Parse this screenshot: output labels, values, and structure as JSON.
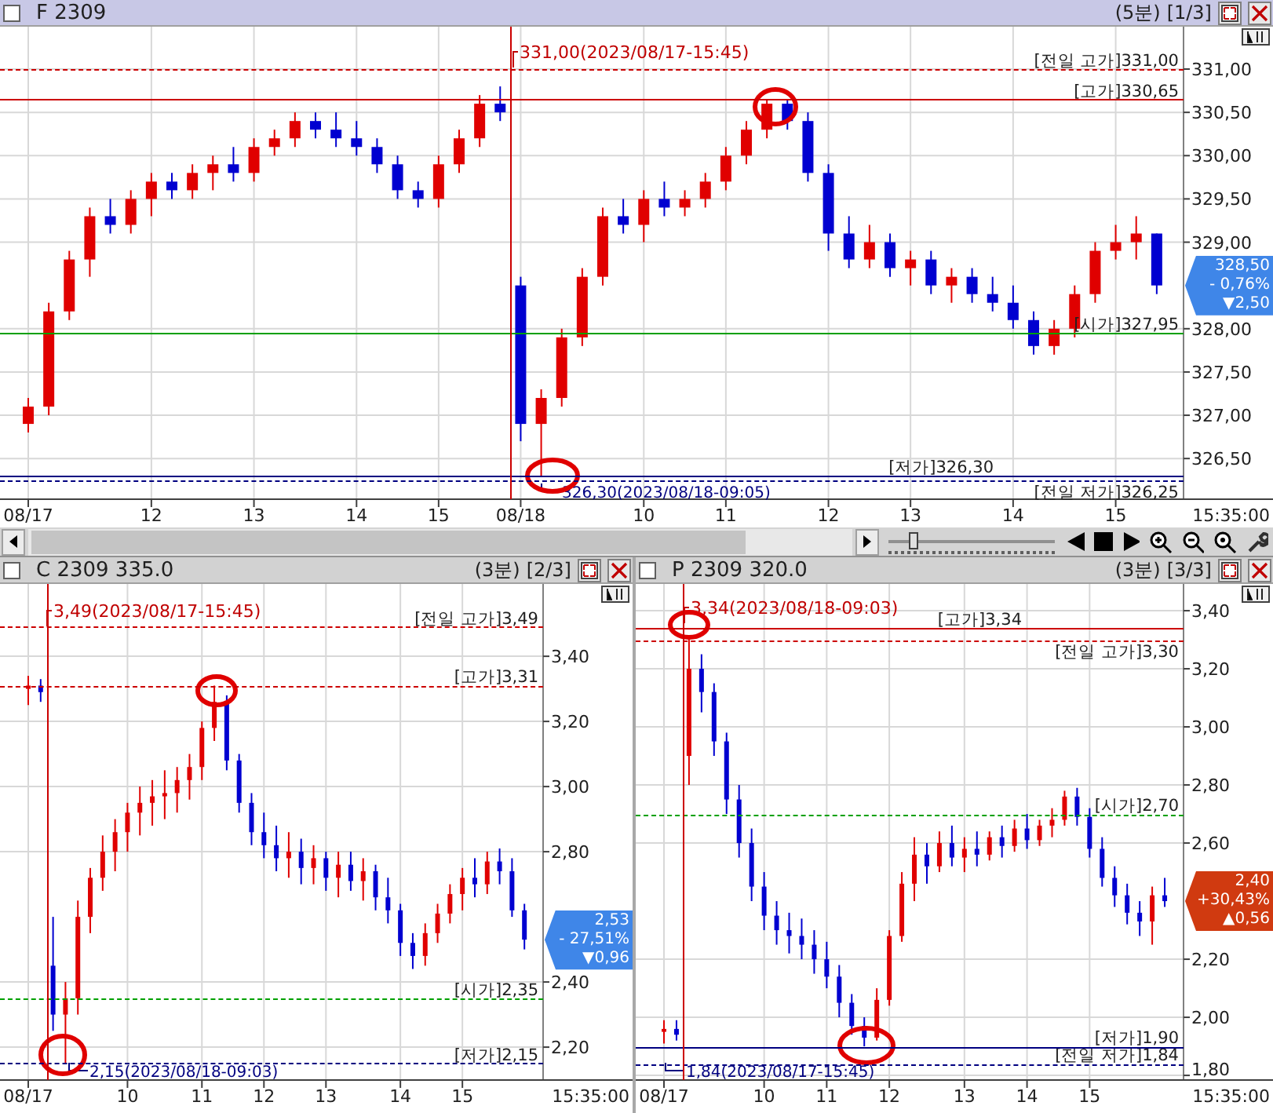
{
  "main_panel": {
    "title": "F 2309",
    "checked": false,
    "period": "(5분)",
    "page": "[1/3]",
    "chart_data": {
      "type": "candlestick",
      "categories": [
        "08/17",
        null,
        null,
        null,
        null,
        null,
        "12",
        null,
        null,
        null,
        null,
        "13",
        null,
        null,
        null,
        null,
        "14",
        null,
        null,
        null,
        "15",
        null,
        null,
        null,
        "08/18",
        null,
        null,
        null,
        null,
        null,
        "10",
        null,
        null,
        null,
        "11",
        null,
        null,
        null,
        null,
        "12",
        null,
        null,
        null,
        "13",
        null,
        null,
        null,
        null,
        "14",
        null,
        null,
        null,
        null,
        "15",
        null,
        null
      ],
      "ohlc": [
        [
          326.9,
          327.2,
          326.8,
          327.1
        ],
        [
          327.1,
          328.3,
          327.0,
          328.2
        ],
        [
          328.2,
          328.9,
          328.1,
          328.8
        ],
        [
          328.8,
          329.4,
          328.6,
          329.3
        ],
        [
          329.3,
          329.5,
          329.1,
          329.2
        ],
        [
          329.2,
          329.6,
          329.1,
          329.5
        ],
        [
          329.5,
          329.8,
          329.3,
          329.7
        ],
        [
          329.7,
          329.8,
          329.5,
          329.6
        ],
        [
          329.6,
          329.9,
          329.5,
          329.8
        ],
        [
          329.8,
          330.0,
          329.6,
          329.9
        ],
        [
          329.9,
          330.1,
          329.7,
          329.8
        ],
        [
          329.8,
          330.2,
          329.7,
          330.1
        ],
        [
          330.1,
          330.3,
          330.0,
          330.2
        ],
        [
          330.2,
          330.5,
          330.1,
          330.4
        ],
        [
          330.4,
          330.5,
          330.2,
          330.3
        ],
        [
          330.3,
          330.5,
          330.1,
          330.2
        ],
        [
          330.2,
          330.4,
          330.0,
          330.1
        ],
        [
          330.1,
          330.2,
          329.8,
          329.9
        ],
        [
          329.9,
          330.0,
          329.5,
          329.6
        ],
        [
          329.6,
          329.7,
          329.4,
          329.5
        ],
        [
          329.5,
          330.0,
          329.4,
          329.9
        ],
        [
          329.9,
          330.3,
          329.8,
          330.2
        ],
        [
          330.2,
          330.7,
          330.1,
          330.6
        ],
        [
          330.6,
          330.8,
          330.4,
          330.5
        ],
        [
          328.5,
          328.6,
          326.7,
          326.9
        ],
        [
          326.9,
          327.3,
          326.3,
          327.2
        ],
        [
          327.2,
          328.0,
          327.1,
          327.9
        ],
        [
          327.9,
          328.7,
          327.8,
          328.6
        ],
        [
          328.6,
          329.4,
          328.5,
          329.3
        ],
        [
          329.3,
          329.5,
          329.1,
          329.2
        ],
        [
          329.2,
          329.6,
          329.0,
          329.5
        ],
        [
          329.5,
          329.7,
          329.3,
          329.4
        ],
        [
          329.4,
          329.6,
          329.3,
          329.5
        ],
        [
          329.5,
          329.8,
          329.4,
          329.7
        ],
        [
          329.7,
          330.1,
          329.6,
          330.0
        ],
        [
          330.0,
          330.4,
          329.9,
          330.3
        ],
        [
          330.3,
          330.65,
          330.2,
          330.6
        ],
        [
          330.6,
          330.65,
          330.3,
          330.4
        ],
        [
          330.4,
          330.5,
          329.7,
          329.8
        ],
        [
          329.8,
          329.9,
          328.9,
          329.1
        ],
        [
          329.1,
          329.3,
          328.7,
          328.8
        ],
        [
          328.8,
          329.2,
          328.7,
          329.0
        ],
        [
          329.0,
          329.1,
          328.6,
          328.7
        ],
        [
          328.7,
          328.9,
          328.5,
          328.8
        ],
        [
          328.8,
          328.9,
          328.4,
          328.5
        ],
        [
          328.5,
          328.7,
          328.3,
          328.6
        ],
        [
          328.6,
          328.7,
          328.3,
          328.4
        ],
        [
          328.4,
          328.6,
          328.2,
          328.3
        ],
        [
          328.3,
          328.5,
          328.0,
          328.1
        ],
        [
          328.1,
          328.2,
          327.7,
          327.8
        ],
        [
          327.8,
          328.1,
          327.7,
          328.0
        ],
        [
          328.0,
          328.5,
          327.9,
          328.4
        ],
        [
          328.4,
          329.0,
          328.3,
          328.9
        ],
        [
          328.9,
          329.2,
          328.8,
          329.0
        ],
        [
          329.0,
          329.3,
          328.8,
          329.1
        ],
        [
          329.1,
          329.1,
          328.4,
          328.5
        ]
      ],
      "ylim": [
        326.03,
        331.49
      ],
      "yticks": [
        {
          "value": 331.0,
          "label": "331,00"
        },
        {
          "value": 330.5,
          "label": "330,50"
        },
        {
          "value": 330.0,
          "label": "330,00"
        },
        {
          "value": 329.5,
          "label": "329,50"
        },
        {
          "value": 329.0,
          "label": "329,00"
        },
        {
          "value": 328.0,
          "label": "328,00"
        },
        {
          "value": 327.5,
          "label": "327,50"
        },
        {
          "value": 327.0,
          "label": "327,00"
        },
        {
          "value": 326.5,
          "label": "326,50"
        }
      ],
      "grid": true,
      "ref_lines": [
        {
          "axis": "y",
          "value": 331.0,
          "label": "[전일 고가]331,00",
          "color": "#cc0000"
        },
        {
          "axis": "y",
          "value": 330.65,
          "label": "[고가]330,65",
          "color": "#cc0000"
        },
        {
          "axis": "y",
          "value": 327.95,
          "label": "[시가]327,95",
          "color": "#00a000"
        },
        {
          "axis": "y",
          "value": 326.3,
          "label": "[저가]326,30",
          "color": "#000080"
        },
        {
          "axis": "y",
          "value": 326.25,
          "label": "[전일 저가]326,25",
          "color": "#000080"
        }
      ]
    },
    "time_label": "15:35:00",
    "high_note": "331,00(2023/08/17-15:45)",
    "low_note": "326,30(2023/08/18-09:05)",
    "badge": {
      "price": "328,50",
      "change_pct": "- 0,76%",
      "change": "▼2,50",
      "color": "#3f86e8"
    }
  },
  "toolbar": {
    "zoom_slider": {
      "level": 0.12
    }
  },
  "sub_panels": [
    {
      "title": "C 2309 335.0",
      "checked": false,
      "period": "(3분)",
      "page": "[2/3]",
      "chart_data": {
        "type": "candlestick",
        "categories": [
          "08/17",
          null,
          null,
          null,
          null,
          null,
          null,
          null,
          "10",
          null,
          null,
          null,
          null,
          null,
          "11",
          null,
          null,
          null,
          null,
          "12",
          null,
          null,
          null,
          null,
          "13",
          null,
          null,
          null,
          null,
          null,
          "14",
          null,
          null,
          null,
          null,
          "15",
          null,
          null,
          null,
          null,
          null
        ],
        "ohlc": [
          [
            3.3,
            3.34,
            3.25,
            3.31
          ],
          [
            3.31,
            3.33,
            3.26,
            3.29
          ],
          [
            2.45,
            2.6,
            2.25,
            2.3
          ],
          [
            2.3,
            2.4,
            2.15,
            2.35
          ],
          [
            2.35,
            2.65,
            2.3,
            2.6
          ],
          [
            2.6,
            2.75,
            2.55,
            2.72
          ],
          [
            2.72,
            2.85,
            2.68,
            2.8
          ],
          [
            2.8,
            2.9,
            2.74,
            2.86
          ],
          [
            2.86,
            2.95,
            2.8,
            2.92
          ],
          [
            2.92,
            3.0,
            2.85,
            2.95
          ],
          [
            2.95,
            3.02,
            2.88,
            2.97
          ],
          [
            2.97,
            3.05,
            2.9,
            2.98
          ],
          [
            2.98,
            3.06,
            2.92,
            3.02
          ],
          [
            3.02,
            3.1,
            2.96,
            3.06
          ],
          [
            3.06,
            3.2,
            3.02,
            3.18
          ],
          [
            3.18,
            3.31,
            3.14,
            3.26
          ],
          [
            3.26,
            3.28,
            3.05,
            3.08
          ],
          [
            3.08,
            3.1,
            2.92,
            2.95
          ],
          [
            2.95,
            2.98,
            2.82,
            2.86
          ],
          [
            2.86,
            2.92,
            2.78,
            2.82
          ],
          [
            2.82,
            2.88,
            2.74,
            2.78
          ],
          [
            2.78,
            2.86,
            2.72,
            2.8
          ],
          [
            2.8,
            2.84,
            2.7,
            2.75
          ],
          [
            2.75,
            2.82,
            2.7,
            2.78
          ],
          [
            2.78,
            2.8,
            2.68,
            2.72
          ],
          [
            2.72,
            2.8,
            2.66,
            2.76
          ],
          [
            2.76,
            2.8,
            2.68,
            2.71
          ],
          [
            2.71,
            2.78,
            2.65,
            2.74
          ],
          [
            2.74,
            2.76,
            2.62,
            2.66
          ],
          [
            2.66,
            2.72,
            2.58,
            2.62
          ],
          [
            2.62,
            2.64,
            2.48,
            2.52
          ],
          [
            2.52,
            2.55,
            2.44,
            2.48
          ],
          [
            2.48,
            2.58,
            2.45,
            2.55
          ],
          [
            2.55,
            2.64,
            2.52,
            2.61
          ],
          [
            2.61,
            2.7,
            2.58,
            2.67
          ],
          [
            2.67,
            2.75,
            2.62,
            2.72
          ],
          [
            2.72,
            2.78,
            2.66,
            2.7
          ],
          [
            2.7,
            2.8,
            2.67,
            2.77
          ],
          [
            2.77,
            2.81,
            2.7,
            2.74
          ],
          [
            2.74,
            2.78,
            2.6,
            2.62
          ],
          [
            2.62,
            2.64,
            2.5,
            2.53
          ]
        ],
        "ylim": [
          2.099,
          3.622
        ],
        "yticks": [
          {
            "value": 3.4,
            "label": "3,40"
          },
          {
            "value": 3.2,
            "label": "3,20"
          },
          {
            "value": 3.0,
            "label": "3,00"
          },
          {
            "value": 2.8,
            "label": "2,80"
          },
          {
            "value": 2.4,
            "label": "2,40"
          },
          {
            "value": 2.2,
            "label": "2,20"
          }
        ],
        "grid": true,
        "ref_lines": [
          {
            "axis": "y",
            "value": 3.49,
            "label": "[전일 고가]3,49",
            "color": "#cc0000"
          },
          {
            "axis": "y",
            "value": 3.31,
            "label": "[고가]3,31",
            "color": "#cc0000"
          },
          {
            "axis": "y",
            "value": 2.35,
            "label": "[시가]2,35",
            "color": "#00a000"
          },
          {
            "axis": "y",
            "value": 2.15,
            "label": "[저가]2,15",
            "color": "#000080"
          }
        ]
      },
      "time_label": "15:35:00",
      "high_note": "3,49(2023/08/17-15:45)",
      "low_note": "2,15(2023/08/18-09:03)",
      "badge": {
        "price": "2,53",
        "change_pct": "- 27,51%",
        "change": "▼0,96",
        "color": "#3f86e8"
      }
    },
    {
      "title": "P 2309 320.0",
      "checked": false,
      "period": "(3분)",
      "page": "[3/3]",
      "chart_data": {
        "type": "candlestick",
        "categories": [
          "08/17",
          null,
          null,
          null,
          null,
          null,
          null,
          null,
          "10",
          null,
          null,
          null,
          null,
          "11",
          null,
          null,
          null,
          null,
          "12",
          null,
          null,
          null,
          null,
          null,
          "13",
          null,
          null,
          null,
          null,
          "14",
          null,
          null,
          null,
          null,
          "15",
          null,
          null,
          null,
          null,
          null,
          null
        ],
        "ohlc": [
          [
            1.95,
            1.99,
            1.91,
            1.96
          ],
          [
            1.96,
            1.99,
            1.92,
            1.94
          ],
          [
            2.9,
            3.3,
            2.8,
            3.2
          ],
          [
            3.2,
            3.25,
            3.05,
            3.12
          ],
          [
            3.12,
            3.15,
            2.9,
            2.95
          ],
          [
            2.95,
            2.98,
            2.7,
            2.75
          ],
          [
            2.75,
            2.8,
            2.55,
            2.6
          ],
          [
            2.6,
            2.65,
            2.4,
            2.45
          ],
          [
            2.45,
            2.5,
            2.3,
            2.35
          ],
          [
            2.35,
            2.4,
            2.25,
            2.3
          ],
          [
            2.3,
            2.36,
            2.22,
            2.28
          ],
          [
            2.28,
            2.34,
            2.2,
            2.25
          ],
          [
            2.25,
            2.3,
            2.15,
            2.2
          ],
          [
            2.2,
            2.26,
            2.1,
            2.14
          ],
          [
            2.14,
            2.18,
            2.0,
            2.05
          ],
          [
            2.05,
            2.08,
            1.94,
            1.97
          ],
          [
            1.97,
            2.0,
            1.9,
            1.93
          ],
          [
            1.93,
            2.1,
            1.92,
            2.06
          ],
          [
            2.06,
            2.3,
            2.04,
            2.28
          ],
          [
            2.28,
            2.5,
            2.26,
            2.46
          ],
          [
            2.46,
            2.62,
            2.4,
            2.56
          ],
          [
            2.56,
            2.6,
            2.46,
            2.52
          ],
          [
            2.52,
            2.64,
            2.5,
            2.6
          ],
          [
            2.6,
            2.66,
            2.52,
            2.55
          ],
          [
            2.55,
            2.62,
            2.5,
            2.58
          ],
          [
            2.58,
            2.64,
            2.52,
            2.56
          ],
          [
            2.56,
            2.64,
            2.54,
            2.62
          ],
          [
            2.62,
            2.66,
            2.55,
            2.59
          ],
          [
            2.59,
            2.68,
            2.57,
            2.65
          ],
          [
            2.65,
            2.7,
            2.58,
            2.61
          ],
          [
            2.61,
            2.68,
            2.59,
            2.66
          ],
          [
            2.66,
            2.72,
            2.62,
            2.68
          ],
          [
            2.68,
            2.78,
            2.66,
            2.76
          ],
          [
            2.76,
            2.79,
            2.66,
            2.69
          ],
          [
            2.69,
            2.72,
            2.55,
            2.58
          ],
          [
            2.58,
            2.62,
            2.45,
            2.48
          ],
          [
            2.48,
            2.52,
            2.38,
            2.42
          ],
          [
            2.42,
            2.46,
            2.32,
            2.36
          ],
          [
            2.36,
            2.4,
            2.28,
            2.33
          ],
          [
            2.33,
            2.45,
            2.25,
            2.42
          ],
          [
            2.42,
            2.48,
            2.38,
            2.4
          ]
        ],
        "ylim": [
          1.784,
          3.492
        ],
        "yticks": [
          {
            "value": 3.4,
            "label": "3,40"
          },
          {
            "value": 3.2,
            "label": "3,20"
          },
          {
            "value": 3.0,
            "label": "3,00"
          },
          {
            "value": 2.8,
            "label": "2,80"
          },
          {
            "value": 2.6,
            "label": "2,60"
          },
          {
            "value": 2.2,
            "label": "2,20"
          },
          {
            "value": 2.0,
            "label": "2,00"
          },
          {
            "value": 1.8,
            "label": "1,80"
          }
        ],
        "grid": true,
        "ref_lines": [
          {
            "axis": "y",
            "value": 3.34,
            "label": "[고가]3,34",
            "color": "#cc0000"
          },
          {
            "axis": "y",
            "value": 3.3,
            "label": "[전일 고가]3,30",
            "color": "#cc0000"
          },
          {
            "axis": "y",
            "value": 2.7,
            "label": "[시가]2,70",
            "color": "#00a000"
          },
          {
            "axis": "y",
            "value": 1.9,
            "label": "[저가]1,90",
            "color": "#000080"
          },
          {
            "axis": "y",
            "value": 1.84,
            "label": "[전일 저가]1,84",
            "color": "#000080"
          }
        ]
      },
      "time_label": "15:35:00",
      "high_note": "3,34(2023/08/18-09:03)",
      "low_note": "1,84(2023/08/17-15:45)",
      "badge": {
        "price": "2,40",
        "change_pct": "+30,43%",
        "change": "▲0,56",
        "color": "#d03a10"
      }
    }
  ]
}
